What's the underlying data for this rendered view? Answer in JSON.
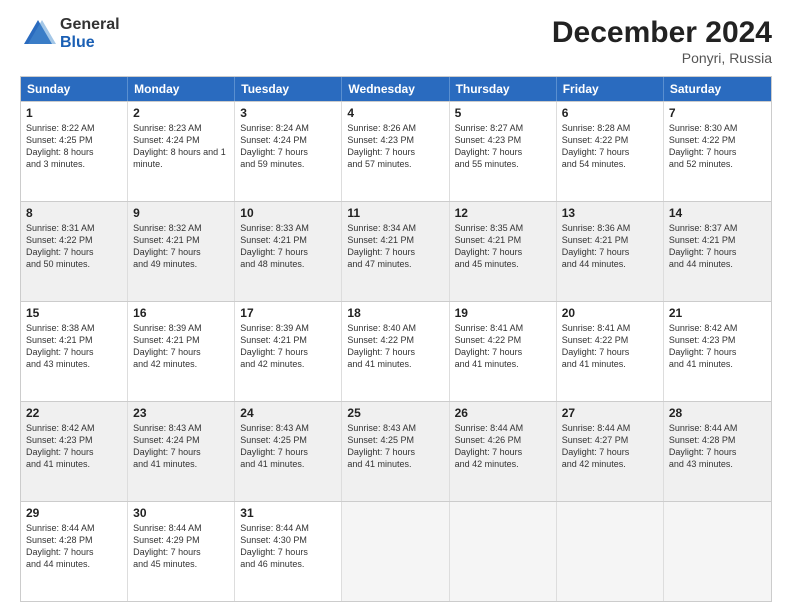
{
  "logo": {
    "general": "General",
    "blue": "Blue"
  },
  "header": {
    "title": "December 2024",
    "subtitle": "Ponyri, Russia"
  },
  "calendar": {
    "weekdays": [
      "Sunday",
      "Monday",
      "Tuesday",
      "Wednesday",
      "Thursday",
      "Friday",
      "Saturday"
    ],
    "rows": [
      [
        {
          "day": "1",
          "sunrise": "8:22 AM",
          "sunset": "4:25 PM",
          "daylight": "8 hours and 3 minutes."
        },
        {
          "day": "2",
          "sunrise": "8:23 AM",
          "sunset": "4:24 PM",
          "daylight": "8 hours and 1 minute."
        },
        {
          "day": "3",
          "sunrise": "8:24 AM",
          "sunset": "4:24 PM",
          "daylight": "7 hours and 59 minutes."
        },
        {
          "day": "4",
          "sunrise": "8:26 AM",
          "sunset": "4:23 PM",
          "daylight": "7 hours and 57 minutes."
        },
        {
          "day": "5",
          "sunrise": "8:27 AM",
          "sunset": "4:23 PM",
          "daylight": "7 hours and 55 minutes."
        },
        {
          "day": "6",
          "sunrise": "8:28 AM",
          "sunset": "4:22 PM",
          "daylight": "7 hours and 54 minutes."
        },
        {
          "day": "7",
          "sunrise": "8:30 AM",
          "sunset": "4:22 PM",
          "daylight": "7 hours and 52 minutes."
        }
      ],
      [
        {
          "day": "8",
          "sunrise": "8:31 AM",
          "sunset": "4:22 PM",
          "daylight": "7 hours and 50 minutes."
        },
        {
          "day": "9",
          "sunrise": "8:32 AM",
          "sunset": "4:21 PM",
          "daylight": "7 hours and 49 minutes."
        },
        {
          "day": "10",
          "sunrise": "8:33 AM",
          "sunset": "4:21 PM",
          "daylight": "7 hours and 48 minutes."
        },
        {
          "day": "11",
          "sunrise": "8:34 AM",
          "sunset": "4:21 PM",
          "daylight": "7 hours and 47 minutes."
        },
        {
          "day": "12",
          "sunrise": "8:35 AM",
          "sunset": "4:21 PM",
          "daylight": "7 hours and 45 minutes."
        },
        {
          "day": "13",
          "sunrise": "8:36 AM",
          "sunset": "4:21 PM",
          "daylight": "7 hours and 44 minutes."
        },
        {
          "day": "14",
          "sunrise": "8:37 AM",
          "sunset": "4:21 PM",
          "daylight": "7 hours and 44 minutes."
        }
      ],
      [
        {
          "day": "15",
          "sunrise": "8:38 AM",
          "sunset": "4:21 PM",
          "daylight": "7 hours and 43 minutes."
        },
        {
          "day": "16",
          "sunrise": "8:39 AM",
          "sunset": "4:21 PM",
          "daylight": "7 hours and 42 minutes."
        },
        {
          "day": "17",
          "sunrise": "8:39 AM",
          "sunset": "4:21 PM",
          "daylight": "7 hours and 42 minutes."
        },
        {
          "day": "18",
          "sunrise": "8:40 AM",
          "sunset": "4:22 PM",
          "daylight": "7 hours and 41 minutes."
        },
        {
          "day": "19",
          "sunrise": "8:41 AM",
          "sunset": "4:22 PM",
          "daylight": "7 hours and 41 minutes."
        },
        {
          "day": "20",
          "sunrise": "8:41 AM",
          "sunset": "4:22 PM",
          "daylight": "7 hours and 41 minutes."
        },
        {
          "day": "21",
          "sunrise": "8:42 AM",
          "sunset": "4:23 PM",
          "daylight": "7 hours and 41 minutes."
        }
      ],
      [
        {
          "day": "22",
          "sunrise": "8:42 AM",
          "sunset": "4:23 PM",
          "daylight": "7 hours and 41 minutes."
        },
        {
          "day": "23",
          "sunrise": "8:43 AM",
          "sunset": "4:24 PM",
          "daylight": "7 hours and 41 minutes."
        },
        {
          "day": "24",
          "sunrise": "8:43 AM",
          "sunset": "4:25 PM",
          "daylight": "7 hours and 41 minutes."
        },
        {
          "day": "25",
          "sunrise": "8:43 AM",
          "sunset": "4:25 PM",
          "daylight": "7 hours and 41 minutes."
        },
        {
          "day": "26",
          "sunrise": "8:44 AM",
          "sunset": "4:26 PM",
          "daylight": "7 hours and 42 minutes."
        },
        {
          "day": "27",
          "sunrise": "8:44 AM",
          "sunset": "4:27 PM",
          "daylight": "7 hours and 42 minutes."
        },
        {
          "day": "28",
          "sunrise": "8:44 AM",
          "sunset": "4:28 PM",
          "daylight": "7 hours and 43 minutes."
        }
      ],
      [
        {
          "day": "29",
          "sunrise": "8:44 AM",
          "sunset": "4:28 PM",
          "daylight": "7 hours and 44 minutes."
        },
        {
          "day": "30",
          "sunrise": "8:44 AM",
          "sunset": "4:29 PM",
          "daylight": "7 hours and 45 minutes."
        },
        {
          "day": "31",
          "sunrise": "8:44 AM",
          "sunset": "4:30 PM",
          "daylight": "7 hours and 46 minutes."
        },
        null,
        null,
        null,
        null
      ]
    ]
  }
}
